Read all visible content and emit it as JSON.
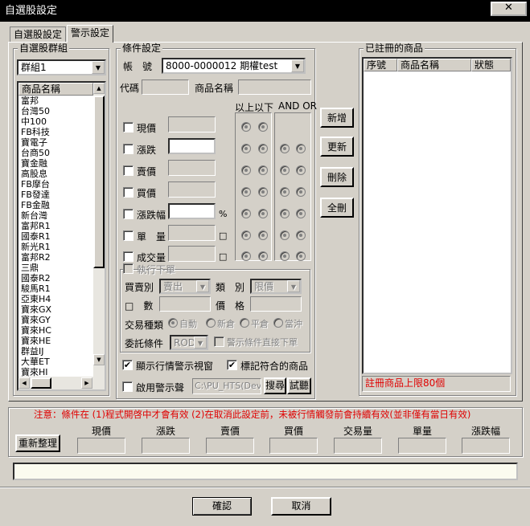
{
  "window": {
    "title": "自選股設定",
    "close_symbol": "✕"
  },
  "tabs": [
    {
      "label": "自選股設定"
    },
    {
      "label": "警示設定"
    }
  ],
  "group_panel": {
    "title": "自選股群組",
    "selected_group": "群組1",
    "list_header": "商品名稱",
    "items": [
      "富邦",
      "台灣50",
      "中100",
      "FB科技",
      "寶電子",
      "台商50",
      "寶金融",
      "高股息",
      "FB摩台",
      "FB發達",
      "FB金融",
      "新台灣",
      "富邦R1",
      "國泰R1",
      "新光R1",
      "富邦R2",
      "三鼎",
      "國泰R2",
      "駿馬R1",
      "亞東H4",
      "寶來GX",
      "寶來GY",
      "寶來HC",
      "寶來HE",
      "群益IJ",
      "大華ET",
      "寶來HI"
    ]
  },
  "conditions": {
    "title": "條件設定",
    "account_label": "帳　號",
    "account_value": "8000-0000012 期權test",
    "code_label": "代碼",
    "product_name_label": "商品名稱",
    "col_above_below": "以上以下",
    "col_and_or": "AND OR",
    "rows": [
      {
        "label": "現價"
      },
      {
        "label": "漲跌"
      },
      {
        "label": "賣價"
      },
      {
        "label": "買價"
      },
      {
        "label": "漲跌幅",
        "suffix": "%"
      },
      {
        "label": "單　量",
        "suffix": "□"
      },
      {
        "label": "成交量",
        "suffix": "□"
      }
    ],
    "execute_order": {
      "label": "執行下單",
      "buy_sell_label": "買賣別",
      "buy_sell_value": "賣出",
      "type_label": "類　別",
      "type_value": "限價",
      "qty_label": "□　數",
      "price_label": "價　格",
      "trade_type_label": "交易種類",
      "trade_options": [
        "自動",
        "新倉",
        "平倉",
        "當沖"
      ],
      "order_cond_label": "委託條件",
      "order_cond_value": "ROD",
      "direct_order_label": "警示條件直接下單"
    },
    "show_alert_window": {
      "label": "顯示行情警示視窗",
      "checked": "✔"
    },
    "mark_matching": {
      "label": "標記符合的商品",
      "checked": "✔"
    },
    "enable_sound": {
      "label": "啟用警示聲"
    },
    "sound_path": "C:\\PU_HTS(Deve",
    "browse_label": "搜尋",
    "test_label": "試聽"
  },
  "actions": {
    "add": "新增",
    "update": "更新",
    "delete": "刪除",
    "clear": "全刪"
  },
  "registered": {
    "title": "已註冊的商品",
    "columns": [
      "序號",
      "商品名稱",
      "狀態"
    ],
    "limit_note": "註冊商品上限80個"
  },
  "notice": "注意：條件在 (1)程式開啓中才會有效 (2)在取消此設定前，未被行情觸發前會持續有效(並非僅有當日有效)",
  "summary": {
    "reset_label": "重新整理",
    "fields": [
      "現價",
      "漲跌",
      "賣價",
      "買價",
      "交易量",
      "單量",
      "漲跌幅"
    ]
  },
  "footer": {
    "ok": "確認",
    "cancel": "取消"
  },
  "colors": {
    "titlebar": "#000000",
    "face": "#d4d0c8",
    "notice": "#e00000"
  }
}
